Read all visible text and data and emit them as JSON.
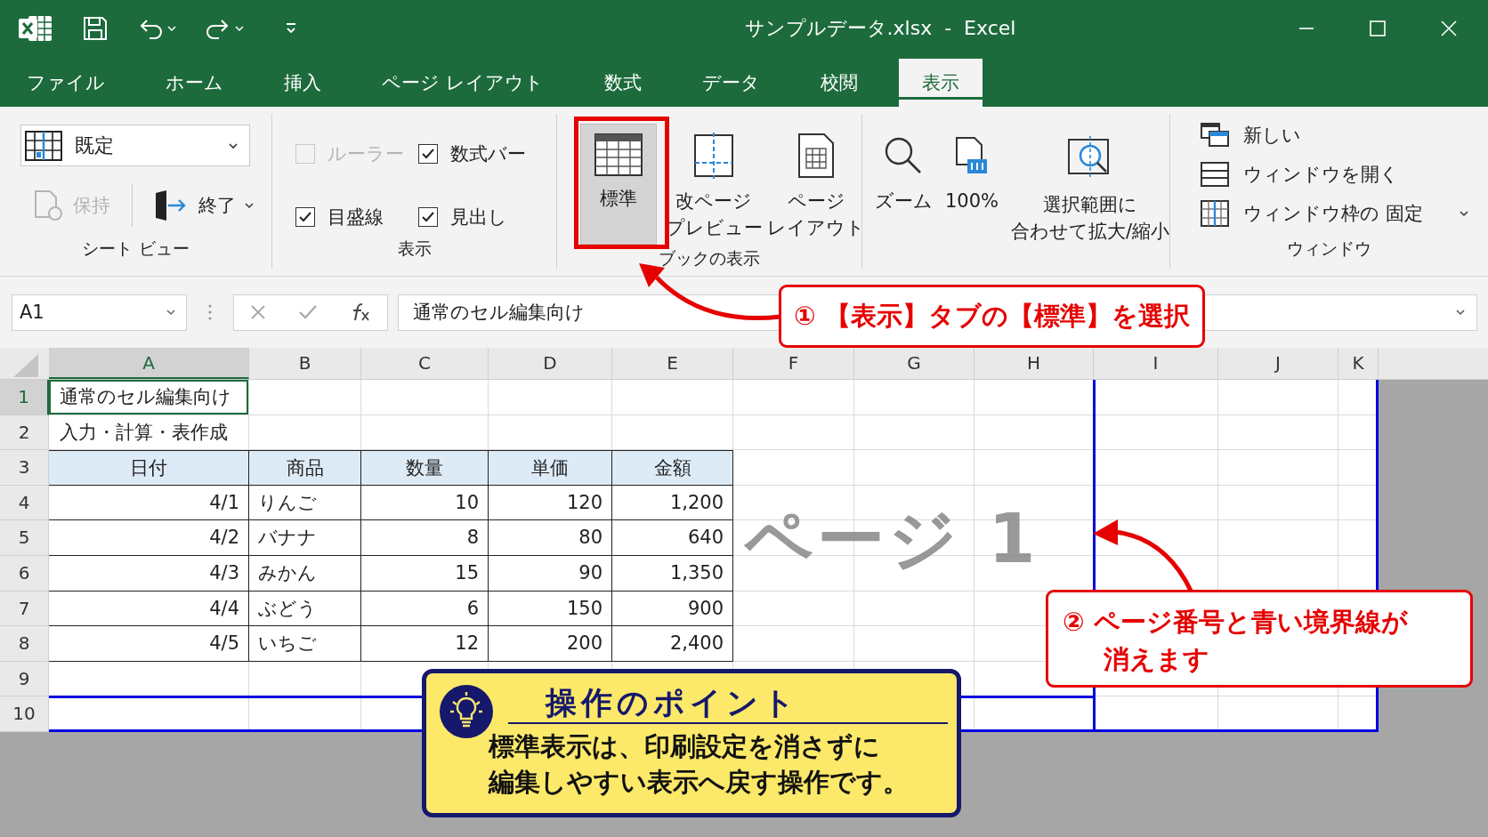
{
  "window": {
    "title": "サンプルデータ.xlsx  -  Excel"
  },
  "tabs": [
    {
      "label": "ファイル",
      "selected": false
    },
    {
      "label": "ホーム",
      "selected": false
    },
    {
      "label": "挿入",
      "selected": false
    },
    {
      "label": "ページ レイアウト",
      "selected": false
    },
    {
      "label": "数式",
      "selected": false
    },
    {
      "label": "データ",
      "selected": false
    },
    {
      "label": "校閲",
      "selected": false
    },
    {
      "label": "表示",
      "selected": true
    }
  ],
  "sheet_view": {
    "view": "既定",
    "keep": {
      "label": "保持",
      "disabled": true
    },
    "exit": "終了",
    "label": "シート ビュー"
  },
  "show": {
    "label": "表示",
    "checkboxes": [
      {
        "label": "ルーラー",
        "checked": false,
        "disabled": true
      },
      {
        "label": "数式バー",
        "checked": true,
        "disabled": false
      },
      {
        "label": "目盛線",
        "checked": true,
        "disabled": false
      },
      {
        "label": "見出し",
        "checked": true,
        "disabled": false
      }
    ]
  },
  "workbook_views": {
    "label": "ブックの表示",
    "views": [
      {
        "kind": "normal",
        "lines": [
          "標準"
        ],
        "selected": true
      },
      {
        "kind": "page_break",
        "lines": [
          "改ページ",
          "プレビュー"
        ],
        "selected": false
      },
      {
        "kind": "page_layout",
        "lines": [
          "ページ",
          "レイアウト"
        ],
        "selected": false
      }
    ]
  },
  "zoom": {
    "buttons": [
      {
        "kind": "zoom",
        "lines": [
          "ズーム"
        ]
      },
      {
        "kind": "hundred",
        "lines": [
          "100%"
        ]
      },
      {
        "kind": "fit",
        "lines": [
          "選択範囲に",
          "合わせて拡大/縮小"
        ]
      }
    ]
  },
  "window_group": {
    "label": "ウィンドウ",
    "items": [
      {
        "kind": "new",
        "label": "新しい",
        "dropdown": false
      },
      {
        "kind": "arrange",
        "label": "ウィンドウを開く",
        "dropdown": false
      },
      {
        "kind": "freeze",
        "label": "ウィンドウ枠の 固定",
        "dropdown": true
      }
    ]
  },
  "formula_bar": {
    "name_box": "A1",
    "value": "通常のセル編集向け"
  },
  "sheet": {
    "columns": [
      {
        "label": "A",
        "selected": true
      },
      {
        "label": "B",
        "selected": false
      },
      {
        "label": "C",
        "selected": false
      },
      {
        "label": "D",
        "selected": false
      },
      {
        "label": "E",
        "selected": false
      },
      {
        "label": "F",
        "selected": false
      },
      {
        "label": "G",
        "selected": false
      },
      {
        "label": "H",
        "selected": false
      },
      {
        "label": "I",
        "selected": false
      },
      {
        "label": "J",
        "selected": false
      },
      {
        "label": "K",
        "selected": false
      }
    ],
    "rows": [
      {
        "header": "1",
        "selected": true,
        "kind": "text",
        "cells": [
          "通常のセル編集向け"
        ]
      },
      {
        "header": "2",
        "selected": false,
        "kind": "text",
        "cells": [
          "入力・計算・表作成"
        ]
      },
      {
        "header": "3",
        "selected": false,
        "kind": "header",
        "cells": [
          "日付",
          "商品",
          "数量",
          "単価",
          "金額"
        ]
      },
      {
        "header": "4",
        "selected": false,
        "kind": "data",
        "cells": [
          "4/1",
          "りんご",
          "10",
          "120",
          "1,200"
        ]
      },
      {
        "header": "5",
        "selected": false,
        "kind": "data",
        "cells": [
          "4/2",
          "バナナ",
          "8",
          "80",
          "640"
        ]
      },
      {
        "header": "6",
        "selected": false,
        "kind": "data",
        "cells": [
          "4/3",
          "みかん",
          "15",
          "90",
          "1,350"
        ]
      },
      {
        "header": "7",
        "selected": false,
        "kind": "data",
        "cells": [
          "4/4",
          "ぶどう",
          "6",
          "150",
          "900"
        ]
      },
      {
        "header": "8",
        "selected": false,
        "kind": "data",
        "cells": [
          "4/5",
          "いちご",
          "12",
          "200",
          "2,400"
        ]
      },
      {
        "header": "9",
        "selected": false
      },
      {
        "header": "10",
        "selected": false
      }
    ]
  },
  "page_label": "ページ 1",
  "callouts": [
    {
      "lines": [
        "① 【表示】タブの【標準】を選択"
      ]
    },
    {
      "lines": [
        "② ページ番号と青い境界線が",
        "消えます"
      ]
    }
  ],
  "tip": {
    "title": "操作のポイント",
    "lines": [
      "標準表示は、印刷設定を消さずに",
      "編集しやすい表示へ戻す操作です。"
    ]
  }
}
